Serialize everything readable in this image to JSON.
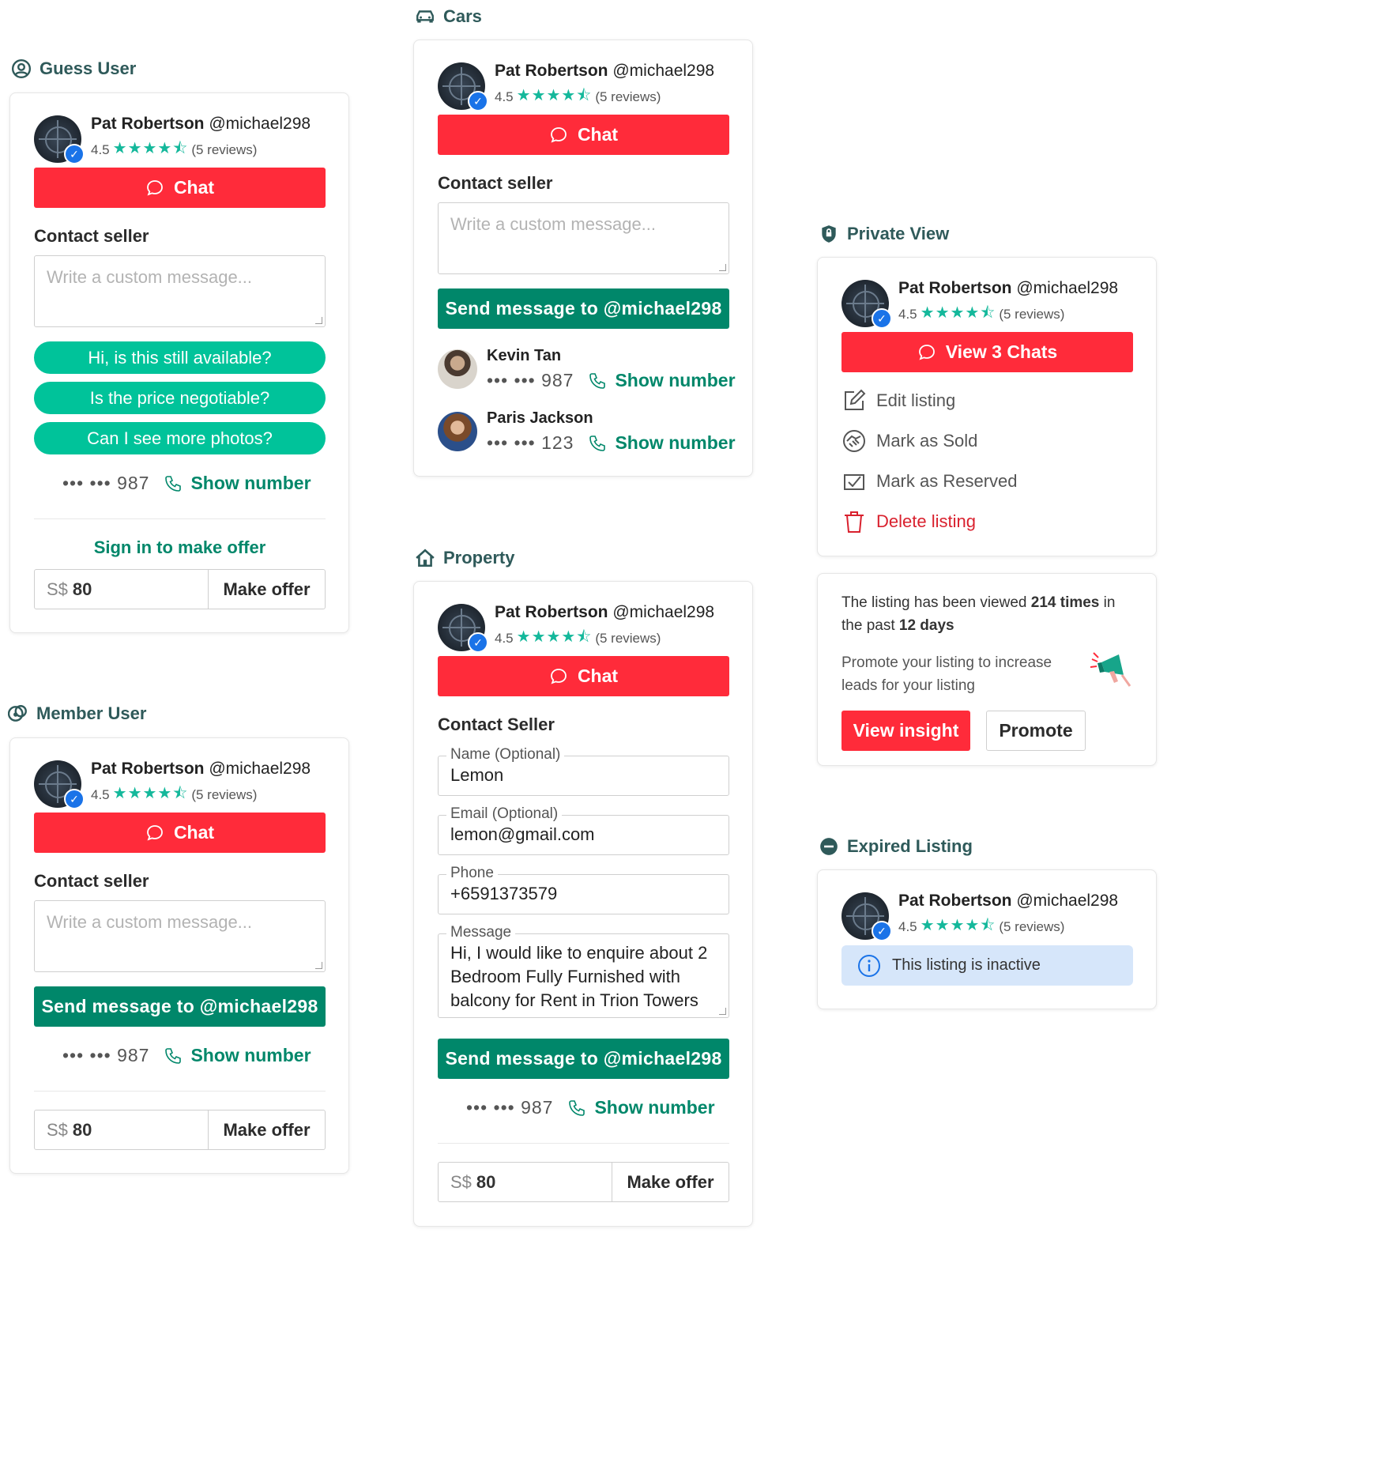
{
  "seller": {
    "name": "Pat Robertson",
    "handle": "@michael298",
    "rating": "4.5",
    "reviews": "(5 reviews)"
  },
  "sections": {
    "guess": "Guess User",
    "member": "Member User",
    "cars": "Cars",
    "property": "Property",
    "private": "Private View",
    "expired": "Expired Listing"
  },
  "common": {
    "chat": "Chat",
    "contact_seller": "Contact seller",
    "placeholder": "Write a custom message...",
    "send": "Send message to @michael298",
    "masked_number": "••• ••• 987",
    "show_number": "Show number",
    "currency": "S$",
    "offer_value": "80",
    "make_offer": "Make offer",
    "sign_in": "Sign in to make offer"
  },
  "quick_replies": [
    "Hi, is this still available?",
    "Is the price negotiable?",
    "Can I see more photos?"
  ],
  "cars": {
    "contacts": [
      {
        "name": "Kevin Tan",
        "masked": "••• ••• 987",
        "show": "Show number"
      },
      {
        "name": "Paris Jackson",
        "masked": "••• ••• 123",
        "show": "Show number"
      }
    ]
  },
  "property": {
    "contact_title": "Contact Seller",
    "fields": [
      {
        "label": "Name (Optional)",
        "value": "Lemon"
      },
      {
        "label": "Email (Optional)",
        "value": "lemon@gmail.com"
      },
      {
        "label": "Phone",
        "value": "+6591373579"
      },
      {
        "label": "Message",
        "value": "Hi, I would like to enquire about 2 Bedroom Fully Furnished with balcony for Rent in Trion Towers"
      }
    ]
  },
  "private": {
    "view_chats": "View 3 Chats",
    "actions": [
      "Edit listing",
      "Mark as Sold",
      "Mark as Reserved",
      "Delete listing"
    ],
    "insight_pre": "The listing has been viewed ",
    "insight_count": "214 times",
    "insight_mid": " in the past ",
    "insight_days": "12 days",
    "promote_text": "Promote your listing to increase leads for your listing",
    "view_insight": "View insight",
    "promote": "Promote"
  },
  "expired": {
    "notice": "This listing is inactive"
  },
  "colors": {
    "red": "#ff2b3a",
    "green": "#00876a",
    "teal": "#00c39a",
    "section_title": "#2f5a5a",
    "info_bg": "#d6e6fa"
  },
  "icons": [
    "user-circle-icon",
    "members-icon",
    "car-icon",
    "home-icon",
    "shield-icon",
    "minus-circle-icon",
    "chat-bubble-icon",
    "phone-icon",
    "edit-icon",
    "handshake-icon",
    "check-box-icon",
    "trash-icon",
    "info-icon",
    "megaphone-icon",
    "verified-badge-icon"
  ]
}
